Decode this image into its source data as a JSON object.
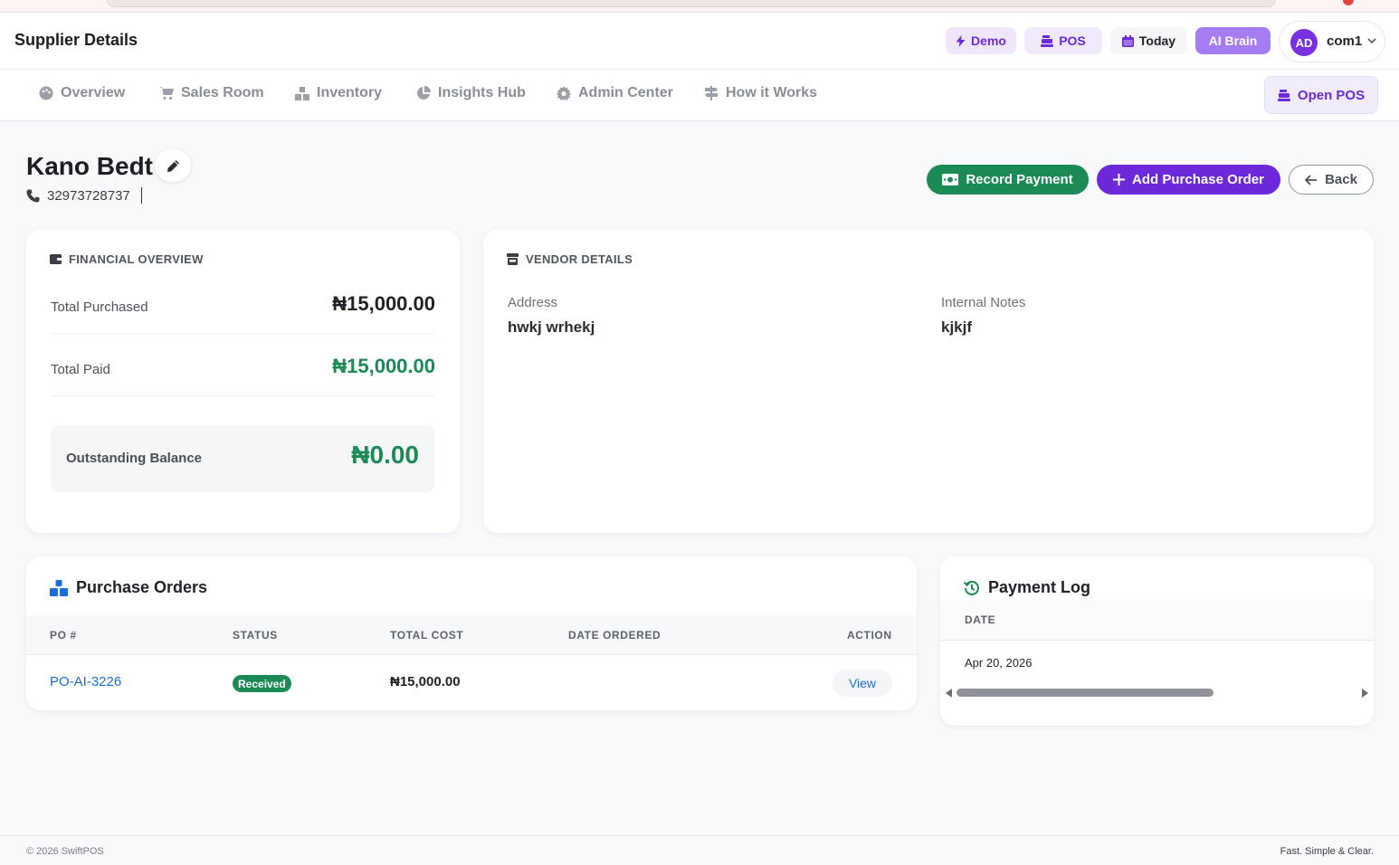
{
  "header": {
    "title": "Supplier Details",
    "chips": {
      "demo": "Demo",
      "pos": "POS",
      "today": "Today",
      "ai": "AI Brain"
    },
    "user": {
      "initials": "AD",
      "name": "com1"
    }
  },
  "nav": {
    "items": [
      "Overview",
      "Sales Room",
      "Inventory",
      "Insights Hub",
      "Admin Center",
      "How it Works"
    ],
    "open_pos": "Open POS"
  },
  "supplier": {
    "name": "Kano Bedt",
    "phone": "32973728737"
  },
  "actions": {
    "record_payment": "Record Payment",
    "add_po": "Add Purchase Order",
    "back": "Back"
  },
  "financial": {
    "title": "FINANCIAL OVERVIEW",
    "total_purchased_label": "Total Purchased",
    "total_purchased": "₦15,000.00",
    "total_paid_label": "Total Paid",
    "total_paid": "₦15,000.00",
    "outstanding_label": "Outstanding Balance",
    "outstanding": "₦0.00"
  },
  "vendor": {
    "title": "VENDOR DETAILS",
    "address_label": "Address",
    "address": "hwkj wrhekj",
    "notes_label": "Internal Notes",
    "notes": "kjkjf"
  },
  "purchase_orders": {
    "title": "Purchase Orders",
    "columns": [
      "PO #",
      "STATUS",
      "TOTAL COST",
      "DATE ORDERED",
      "ACTION"
    ],
    "rows": [
      {
        "po": "PO-AI-3226",
        "status": "Received",
        "total": "₦15,000.00",
        "date": "",
        "action": "View"
      }
    ]
  },
  "payment_log": {
    "title": "Payment Log",
    "columns": [
      "DATE"
    ],
    "rows": [
      {
        "date": "Apr 20, 2026"
      }
    ]
  },
  "footer": {
    "copyright": "© 2026 SwiftPOS",
    "tagline": "Fast. Simple & Clear."
  },
  "colors": {
    "brand_purple": "#6d28d9",
    "success_green": "#1b8a55",
    "link_blue": "#1a6fd6"
  }
}
